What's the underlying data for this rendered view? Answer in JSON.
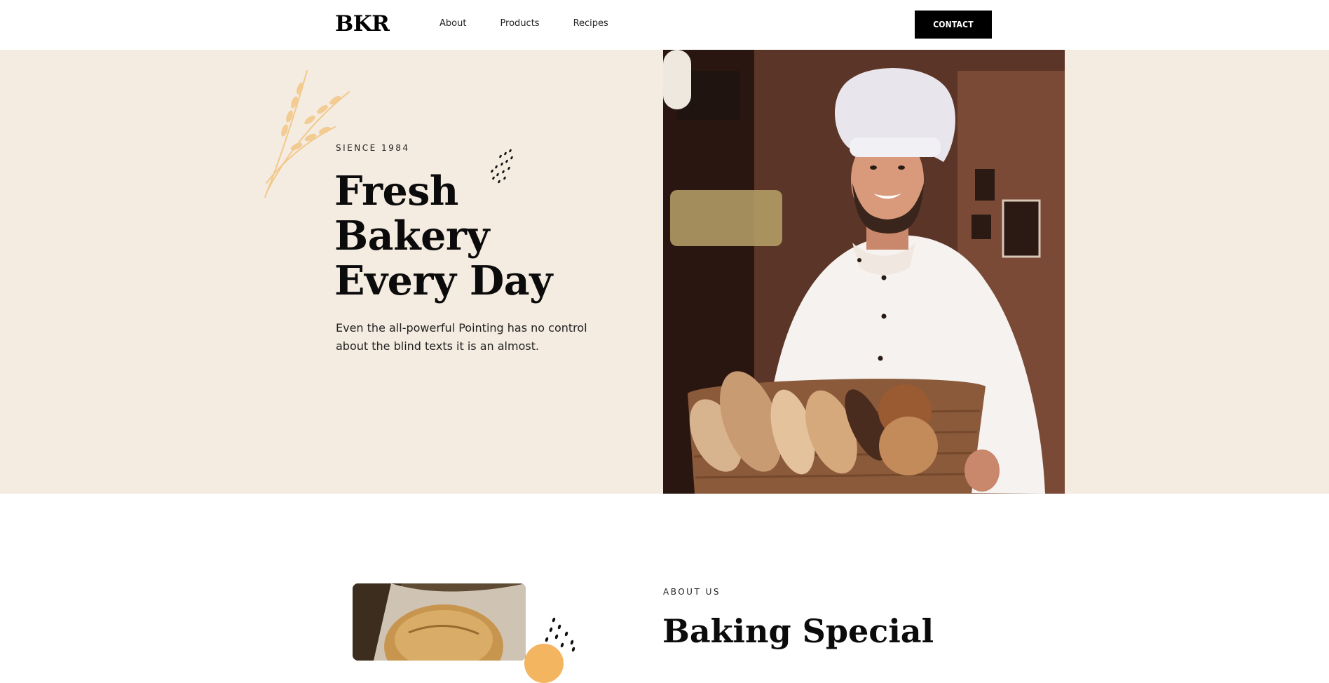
{
  "header": {
    "logo": "BKR",
    "nav": [
      {
        "label": "About"
      },
      {
        "label": "Products"
      },
      {
        "label": "Recipes"
      }
    ],
    "contact_label": "CONTACT"
  },
  "hero": {
    "eyebrow": "SIENCE 1984",
    "title_lines": [
      "Fresh",
      "Bakery",
      "Every Day"
    ],
    "description": "Even the all-powerful Pointing has no control about the blind texts it is an almost."
  },
  "about": {
    "eyebrow": "ABOUT US",
    "title": "Baking Special"
  },
  "colors": {
    "hero_bg": "#f4ebe1",
    "accent_orange": "#f4b561",
    "button_bg": "#000000"
  }
}
